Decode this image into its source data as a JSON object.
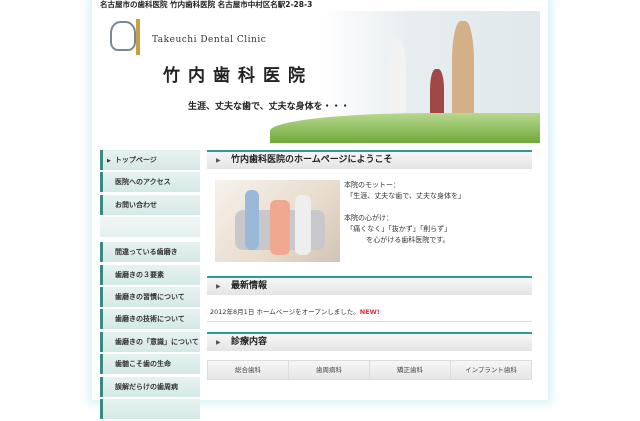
{
  "top_line": "名古屋市の歯科医院 竹内歯科医院 名古屋市中村区名駅2-28-3",
  "header": {
    "en_name": "Takeuchi Dental Clinic",
    "jp_name": "竹内歯科医院",
    "slogan": "生涯、丈夫な歯で、丈夫な身体を・・・"
  },
  "sidebar": {
    "group1": [
      "トップページ",
      "医院へのアクセス",
      "お問い合わせ"
    ],
    "group2": [
      "間違っている歯磨き",
      "歯磨きの３要素",
      "歯磨きの習慣について",
      "歯磨きの技術について",
      "歯磨きの「意識」について",
      "歯髄こそ歯の生命",
      "誤解だらけの歯周病"
    ]
  },
  "welcome": {
    "title": "竹内歯科医院のホームページにようこそ",
    "text": "本院のモットー：\n 「生涯、丈夫な歯で、丈夫な身体を」\n\n本院の心がけ：\n 「痛くなく」「抜かず」「削らず」\n          を心がける歯科医院です。"
  },
  "news": {
    "title": "最新情報",
    "date": "2012年8月1日",
    "text": "ホームページをオープンしました。",
    "badge": "NEW!"
  },
  "services": {
    "title": "診療内容",
    "items": [
      "総合歯科",
      "歯周病科",
      "矯正歯科",
      "インプラント歯科"
    ]
  }
}
